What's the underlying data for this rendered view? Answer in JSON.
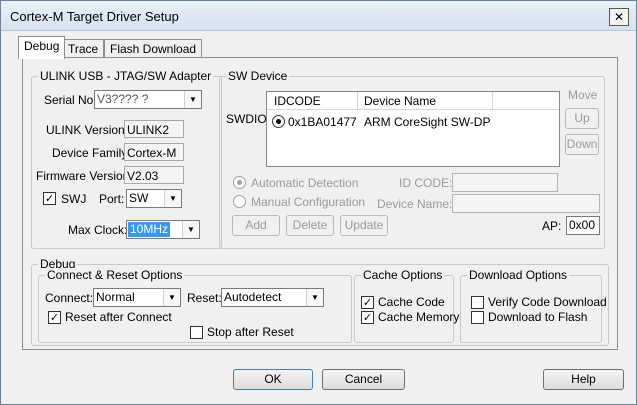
{
  "window": {
    "title": "Cortex-M Target Driver Setup",
    "close_glyph": "✕"
  },
  "tabs": [
    {
      "label": "Debug",
      "active": true
    },
    {
      "label": "Trace",
      "active": false
    },
    {
      "label": "Flash Download",
      "active": false
    }
  ],
  "adapter": {
    "title": "ULINK USB - JTAG/SW Adapter",
    "serial_label": "Serial No:",
    "serial_value": "V3???? ?",
    "version_label": "ULINK Version:",
    "version_value": "ULINK2",
    "family_label": "Device Family:",
    "family_value": "Cortex-M",
    "firmware_label": "Firmware Version:",
    "firmware_value": "V2.03",
    "swj_label": "SWJ",
    "swj_checked": true,
    "port_label": "Port:",
    "port_value": "SW",
    "clock_label": "Max Clock:",
    "clock_value": "10MHz"
  },
  "sw_device": {
    "title": "SW Device",
    "swdio_label": "SWDIO",
    "columns": [
      "IDCODE",
      "Device Name"
    ],
    "rows": [
      {
        "idcode": "0x1BA01477",
        "name": "ARM CoreSight SW-DP",
        "selected": true
      }
    ],
    "move_label": "Move",
    "up_label": "Up",
    "down_label": "Down",
    "auto_detect_label": "Automatic Detection",
    "manual_config_label": "Manual Configuration",
    "id_code_label": "ID CODE:",
    "id_code_value": "",
    "device_name_label": "Device Name:",
    "device_name_value": "",
    "add_label": "Add",
    "delete_label": "Delete",
    "update_label": "Update",
    "ap_label": "AP:",
    "ap_value": "0x00"
  },
  "debug": {
    "title": "Debug",
    "connect_reset": {
      "title": "Connect & Reset Options",
      "connect_label": "Connect:",
      "connect_value": "Normal",
      "reset_label": "Reset:",
      "reset_value": "Autodetect",
      "reset_after_connect_label": "Reset after Connect",
      "reset_after_connect_checked": true,
      "stop_after_reset_label": "Stop after Reset",
      "stop_after_reset_checked": false
    },
    "cache": {
      "title": "Cache Options",
      "cache_code_label": "Cache Code",
      "cache_code_checked": true,
      "cache_memory_label": "Cache Memory",
      "cache_memory_checked": true
    },
    "download": {
      "title": "Download Options",
      "verify_label": "Verify Code Download",
      "verify_checked": false,
      "download_flash_label": "Download to Flash",
      "download_flash_checked": false
    }
  },
  "buttons": {
    "ok": "OK",
    "cancel": "Cancel",
    "help": "Help"
  },
  "glyphs": {
    "check": "✓",
    "dropdown": "▼"
  }
}
